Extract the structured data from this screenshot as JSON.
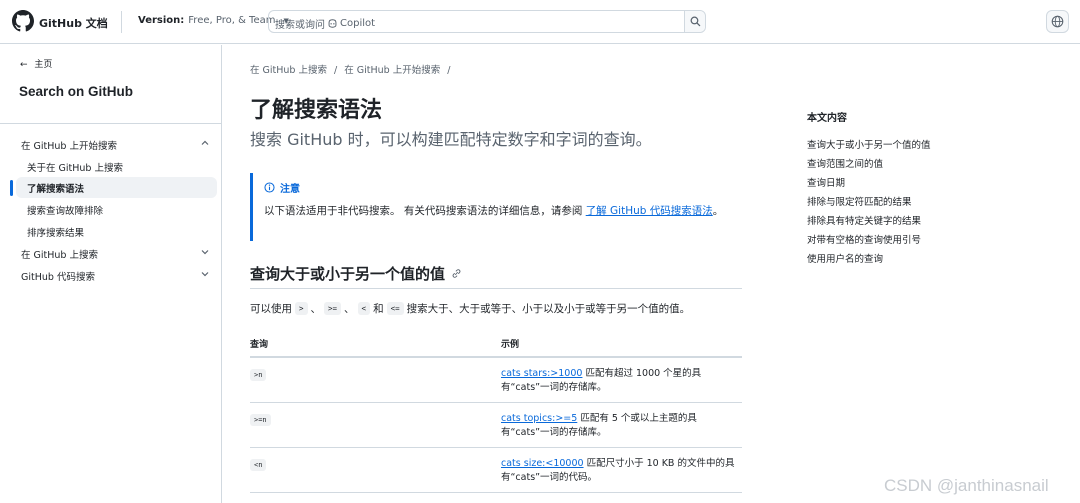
{
  "header": {
    "brand": "GitHub 文档",
    "version_label": "Version:",
    "version_value": "Free, Pro, & Team",
    "search_placeholder_prefix": "搜索或询问",
    "search_placeholder_suffix": "Copilot"
  },
  "sidebar": {
    "home": "主页",
    "title": "Search on GitHub",
    "items": [
      {
        "label": "在 GitHub 上开始搜索",
        "chevron": "up"
      },
      {
        "label": "关于在 GitHub 上搜索"
      },
      {
        "label": "了解搜索语法",
        "active": true
      },
      {
        "label": "搜索查询故障排除"
      },
      {
        "label": "排序搜索结果"
      },
      {
        "label": "在 GitHub 上搜索",
        "chevron": "down"
      },
      {
        "label": "GitHub 代码搜索",
        "chevron": "down"
      }
    ]
  },
  "breadcrumb": [
    "在 GitHub 上搜索",
    "/",
    "在 GitHub 上开始搜索",
    "/"
  ],
  "page": {
    "title": "了解搜索语法",
    "lead": "搜索 GitHub 时，可以构建匹配特定数字和字词的查询。"
  },
  "note": {
    "title": "注意",
    "body_text": "以下语法适用于非代码搜索。 有关代码搜索语法的详细信息，请参阅 ",
    "link_text": "了解 GitHub 代码搜索语法",
    "end": "。"
  },
  "section": {
    "heading": "查询大于或小于另一个值的值",
    "para_prefix": "可以使用",
    "op1": ">",
    "sep1": "、",
    "op2": ">=",
    "sep2": "、",
    "op3": "<",
    "and": "和",
    "op4": "<=",
    "para_suffix": "搜索大于、大于或等于、小于以及小于或等于另一个值的值。"
  },
  "table": {
    "headers": [
      "查询",
      "示例"
    ],
    "rows": [
      {
        "query": ">n",
        "link": "cats stars:>1000",
        "desc": " 匹配有超过 1000 个星的具有“cats”一词的存储库。"
      },
      {
        "query": ">=n",
        "link": "cats topics:>=5",
        "desc": " 匹配有 5 个或以上主题的具有“cats”一词的存储库。"
      },
      {
        "query": "<n",
        "link": "cats size:<10000",
        "desc": " 匹配尺寸小于 10 KB 的文件中的具有“cats”一词的代码。"
      }
    ]
  },
  "toc": {
    "title": "本文内容",
    "items": [
      "查询大于或小于另一个值的值",
      "查询范围之间的值",
      "查询日期",
      "排除与限定符匹配的结果",
      "排除具有特定关键字的结果",
      "对带有空格的查询使用引号",
      "使用用户名的查询"
    ]
  },
  "watermark": "CSDN @janthinasnail",
  "colors": {
    "accent": "#0969da",
    "text": "#1f2328",
    "muted": "#59636e",
    "border": "#d1d9e0"
  }
}
